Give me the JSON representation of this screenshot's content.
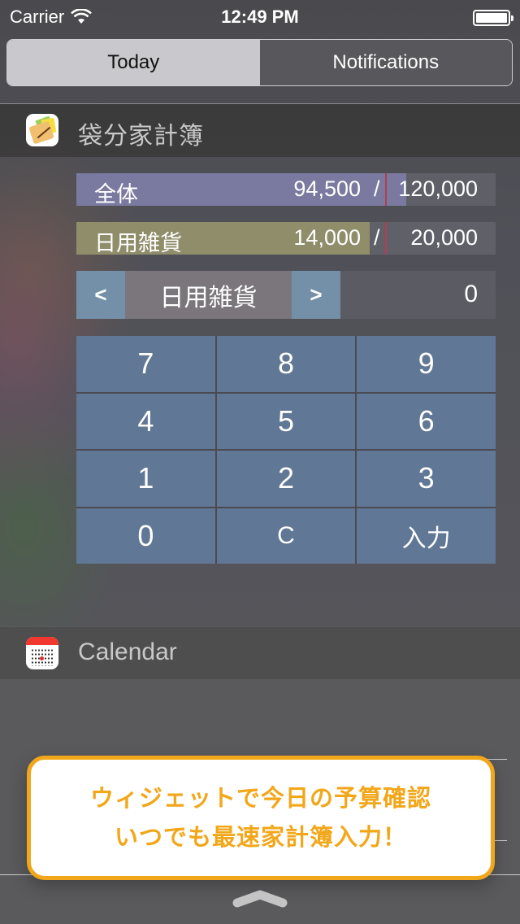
{
  "status_bar": {
    "carrier": "Carrier",
    "time": "12:49 PM",
    "wifi_icon": "wifi-icon",
    "battery_icon": "battery-icon",
    "battery_level": 1.0
  },
  "segmented_control": {
    "tabs": [
      {
        "label": "Today",
        "selected": true
      },
      {
        "label": "Notifications",
        "selected": false
      }
    ]
  },
  "widget": {
    "app_name": "袋分家計簿",
    "app_icon": "notebook-icon",
    "budgets": [
      {
        "label": "全体",
        "spent": "94,500",
        "separator": "/",
        "limit": "120,000",
        "progress": 0.7875,
        "color": "#7a7aa0"
      },
      {
        "label": "日用雑貨",
        "spent": "14,000",
        "separator": "/",
        "limit": "20,000",
        "progress": 0.7,
        "color": "#8f8d6a"
      }
    ],
    "category_selector": {
      "prev_label": "<",
      "category": "日用雑貨",
      "next_label": ">",
      "amount": "0"
    },
    "keypad": {
      "keys": [
        "7",
        "8",
        "9",
        "4",
        "5",
        "6",
        "1",
        "2",
        "3",
        "0",
        "C",
        "入力"
      ]
    },
    "colors": {
      "key_background": "#607795",
      "nav_button": "#7490a8",
      "marker": "#b04050"
    }
  },
  "calendar_widget": {
    "title": "Calendar",
    "icon": "calendar-icon"
  },
  "promo_banner": {
    "line1": "ウィジェットで今日の予算確認",
    "line2": "いつでも最速家計簿入力！",
    "accent_color": "#f2a71a"
  },
  "bottom": {
    "grabber_icon": "chevron-up-handle-icon"
  }
}
